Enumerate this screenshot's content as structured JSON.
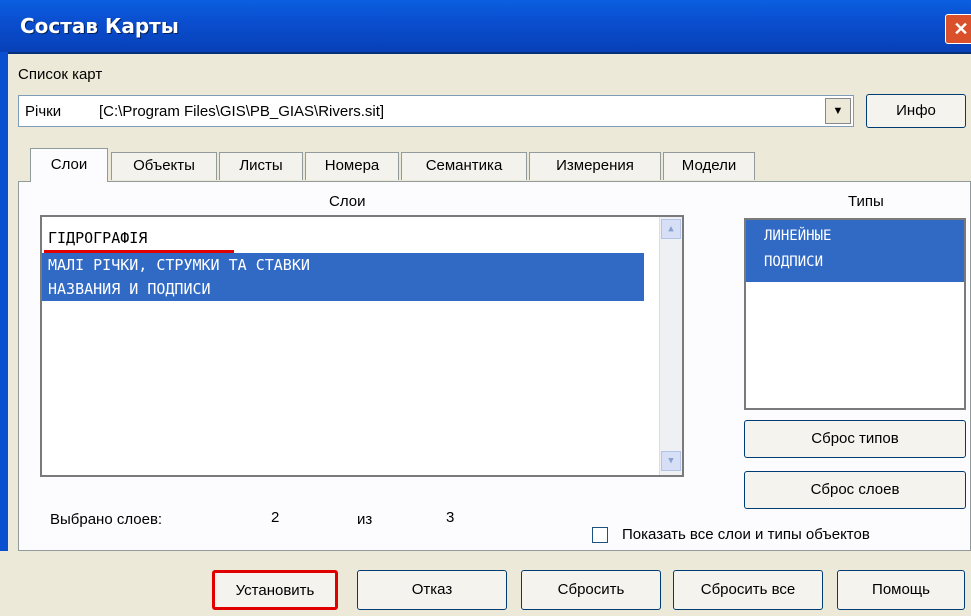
{
  "window": {
    "title": "Состав Карты",
    "close_glyph": "✕"
  },
  "maps": {
    "label": "Список  карт",
    "selected_name": "Річки",
    "selected_path": "[C:\\Program Files\\GIS\\PB_GIAS\\Rivers.sit]",
    "info_button": "Инфо"
  },
  "tabs": [
    "Слои",
    "Объекты",
    "Листы",
    "Номера",
    "Семантика",
    "Измерения",
    "Модели"
  ],
  "layers": {
    "header": "Слои",
    "items": [
      {
        "label": "ГІДРОГРАФІЯ",
        "selected": false
      },
      {
        "label": "МАЛІ РІЧКИ, СТРУМКИ ТА СТАВКИ",
        "selected": true
      },
      {
        "label": "НАЗВАНИЯ И ПОДПИСИ",
        "selected": true
      }
    ]
  },
  "types": {
    "header": "Типы",
    "items": [
      "ЛИНЕЙНЫЕ",
      "ПОДПИСИ"
    ]
  },
  "side_buttons": {
    "reset_types": "Сброс типов",
    "reset_layers": "Сброс слоев"
  },
  "status": {
    "selected_label": "Выбрано слоев:",
    "selected_count": "2",
    "of_label": "из",
    "total_count": "3"
  },
  "show_all": {
    "label": "Показать все слои и типы объектов",
    "checked": false
  },
  "footer": {
    "install": "Установить",
    "cancel": "Отказ",
    "reset": "Сбросить",
    "reset_all": "Сбросить все",
    "help": "Помощь"
  },
  "colors": {
    "title_bar": "#0a4fd0",
    "selection": "#316ac5",
    "highlight_red": "#e00000"
  },
  "icons": {
    "dropdown": "▼",
    "scroll_up": "▲",
    "scroll_down": "▼"
  }
}
